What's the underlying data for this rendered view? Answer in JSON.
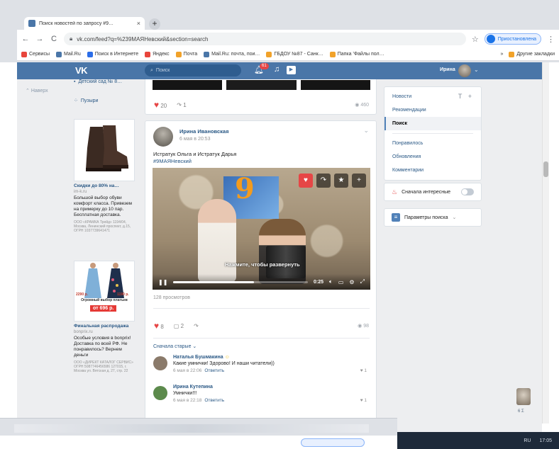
{
  "browser": {
    "tab_title": "Поиск новостей по запросу #9…",
    "tab_close": "×",
    "new_tab": "+",
    "back": "←",
    "forward": "→",
    "reload": "C",
    "url": "vk.com/feed?q=%239МАЯНевский&section=search",
    "bookmark_star": "☆",
    "profile_label": "Приостановлена",
    "menu": "⋮",
    "bookmarks": [
      {
        "label": "Сервисы",
        "color": "#e8453c"
      },
      {
        "label": "Mail.Ru",
        "color": "#4a76a8"
      },
      {
        "label": "Поиск в Интернете",
        "color": "#2b6de8"
      },
      {
        "label": "Яндекс",
        "color": "#e8453c"
      },
      {
        "label": "Почта",
        "color": "#f1a22a"
      },
      {
        "label": "Mail.Ru: почта, пои…",
        "color": "#4a76a8"
      },
      {
        "label": "ГБДОУ №87 - Санк…",
        "color": "#f1a22a"
      },
      {
        "label": "Папка 'Файлы пол…",
        "color": "#f1a22a"
      }
    ],
    "bookmarks_more": "»",
    "other_bookmarks": "Другие закладки"
  },
  "vk_header": {
    "logo": "VK",
    "search_placeholder": "Поиск",
    "notif_count": "61",
    "user_name": "Ирина"
  },
  "left_nav": {
    "back_label": "Наверх",
    "items": [
      {
        "label": "Детский сад № 8…"
      },
      {
        "label": "Пузыри"
      }
    ]
  },
  "ads": [
    {
      "title": "Скидки до 80% на…",
      "domain": "im-k.ru",
      "text": "Большой выбор обуви комфорт класса. Привезем на примерку до 10 пар. Бесплатная доставка.",
      "fine": "ООО «КРАМКА Трейд» 1194/04, Москва, Ленинский проспект, д.15, ОГРН 1037739641471"
    },
    {
      "banner": "Огромный выбор платьев",
      "price_badge": "от 696 р.",
      "price1": "2290 р.",
      "price2": "1190 р.",
      "title": "Финальная распродажа",
      "domain": "bonprix.ru",
      "text": "Особые условия в bonprix! Доставка по всей РФ. Не понравилось? Вернем деньги",
      "fine": "ООО «ДИРЕКТ КАТАЛОГ СЕРВИС» ОГРН 5087746456586 127015, г. Москва ул. Вятская д. 27, стр. 22"
    }
  ],
  "feed": {
    "prev_post": {
      "likes": "20",
      "shares": "1",
      "views": "460"
    },
    "post": {
      "author": "Ирина Ивановская",
      "date": "6 мая в 20:53",
      "text": "Истратук Ольга и Истратук Дарья",
      "hashtag": "#9МАЯНевский",
      "video_caption": "Нажмите, чтобы развернуть",
      "video_time": "0:25",
      "video_progress": 0.6,
      "views_line": "128 просмотров",
      "likes": "8",
      "comments": "2",
      "views": "98"
    },
    "comments_sort": "Сначала старые",
    "comments": [
      {
        "author": "Наталья Бушмакина",
        "text": "Какие умнички! Здорово! И наши читатели))",
        "date": "6 мая в 22:06",
        "reply": "Ответить",
        "likes": "1",
        "avatar_color": "#8a7a6a"
      },
      {
        "author": "Ирина Кутепина",
        "text": "Умнички!!!",
        "date": "6 мая в 22:18",
        "reply": "Ответить",
        "likes": "1",
        "avatar_color": "#5c8a4c"
      }
    ]
  },
  "right_menu": {
    "items": [
      {
        "label": "Новости"
      },
      {
        "label": "Рекомендации"
      },
      {
        "label": "Поиск"
      },
      {
        "label": "Понравилось"
      },
      {
        "label": "Обновления"
      },
      {
        "label": "Комментарии"
      }
    ],
    "tools": "T +",
    "interesting_first": "Сначала интересные",
    "search_params": "Параметры поиска"
  },
  "chat": {
    "count": "6 Σ"
  },
  "taskbar": {
    "lang": "RU",
    "time": "17:05"
  }
}
